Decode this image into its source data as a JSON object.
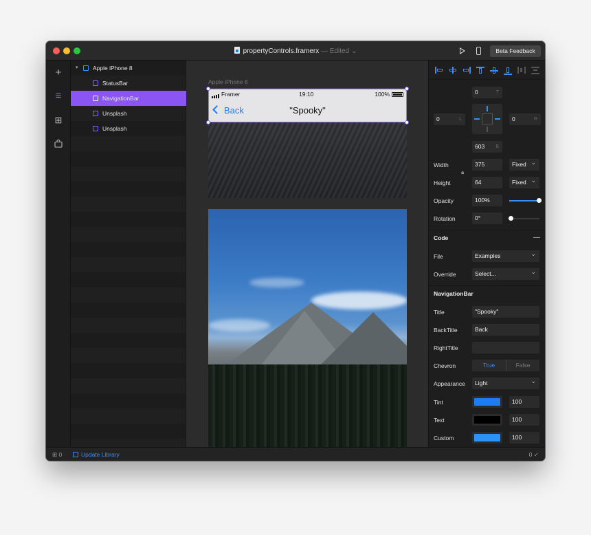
{
  "window": {
    "doc_name": "propertyControls.framerx",
    "edited_label": " — Edited ⌄",
    "beta_button": "Beta Feedback"
  },
  "layers": [
    {
      "label": "Apple iPhone 8",
      "kind": "frame"
    },
    {
      "label": "StatusBar",
      "kind": "component"
    },
    {
      "label": "NavigationBar",
      "kind": "component",
      "selected": true
    },
    {
      "label": "Unsplash",
      "kind": "component"
    },
    {
      "label": "Unsplash",
      "kind": "component"
    }
  ],
  "canvas": {
    "artboard_label": "Apple iPhone 8",
    "status_carrier": "Framer",
    "status_time": "19:10",
    "status_battery": "100%",
    "nav_back": "Back",
    "nav_title": "\"Spooky\""
  },
  "props": {
    "pos_top": "0",
    "pos_top_suffix": "T",
    "pos_left": "0",
    "pos_left_suffix": "L",
    "pos_right": "0",
    "pos_right_suffix": "R",
    "pos_bottom": "603",
    "pos_bottom_suffix": "B",
    "width_label": "Width",
    "width_value": "375",
    "width_mode": "Fixed",
    "height_label": "Height",
    "height_value": "64",
    "height_mode": "Fixed",
    "opacity_label": "Opacity",
    "opacity_value": "100%",
    "opacity_fraction": 1.0,
    "rotation_label": "Rotation",
    "rotation_value": "0°",
    "code_header": "Code",
    "code_collapse": "—",
    "file_label": "File",
    "file_value": "Examples",
    "override_label": "Override",
    "override_value": "Select...",
    "component_header": "NavigationBar",
    "title_label": "Title",
    "title_value": "\"Spooky\"",
    "backtitle_label": "BackTitle",
    "backtitle_value": "Back",
    "righttitle_label": "RightTitle",
    "righttitle_value": "",
    "chevron_label": "Chevron",
    "chevron_true": "True",
    "chevron_false": "False",
    "appearance_label": "Appearance",
    "appearance_value": "Light",
    "tint_label": "Tint",
    "tint_color": "#1d7cf2",
    "tint_alpha": "100",
    "text_label": "Text",
    "text_color": "#000000",
    "text_alpha": "100",
    "custom_label": "Custom",
    "custom_color": "#2a93f5",
    "custom_alpha": "100"
  },
  "bottom": {
    "component_count": "0",
    "update_library": "Update Library",
    "status_count": "0 ✓"
  },
  "colors": {
    "accent": "#3a8ef7",
    "selection": "#8a55f2"
  }
}
